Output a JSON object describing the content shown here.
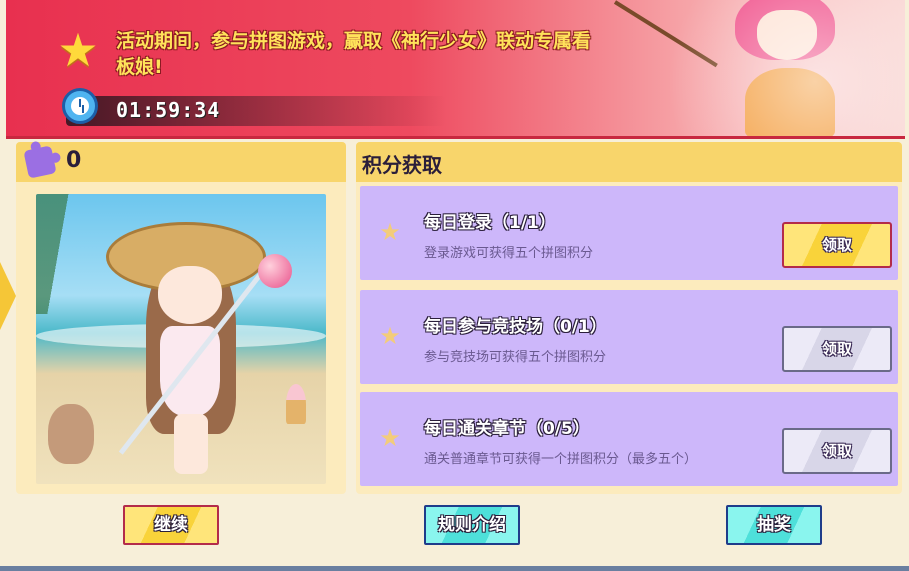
{
  "banner": {
    "message": "活动期间，参与拼图游戏，赢取《神行少女》联动专属看板娘!",
    "timer": "01:59:34"
  },
  "puzzle_panel": {
    "score": "0"
  },
  "points_panel": {
    "title": "积分获取",
    "tasks": [
      {
        "title": "每日登录（1/1）",
        "desc": "登录游戏可获得五个拼图积分",
        "button": "领取",
        "state": "active"
      },
      {
        "title": "每日参与竞技场（0/1）",
        "desc": "参与竞技场可获得五个拼图积分",
        "button": "领取",
        "state": "disabled"
      },
      {
        "title": "每日通关章节（0/5）",
        "desc": "通关普通章节可获得一个拼图积分（最多五个）",
        "button": "领取",
        "state": "disabled"
      }
    ]
  },
  "bottom": {
    "continue_label": "继续",
    "rules_label": "规则介绍",
    "draw_label": "抽奖"
  },
  "colors": {
    "banner_red": "#e8304f",
    "panel_bg": "#fcebbd",
    "panel_header": "#f8d56b",
    "task_bg": "#cdb7fa",
    "button_yellow": "#f9d33a",
    "button_cyan": "#4ee0da"
  },
  "icons": {
    "banner": "star-icon",
    "timer": "alarm-clock-icon",
    "score": "puzzle-piece-icon",
    "task": "star-icon"
  }
}
